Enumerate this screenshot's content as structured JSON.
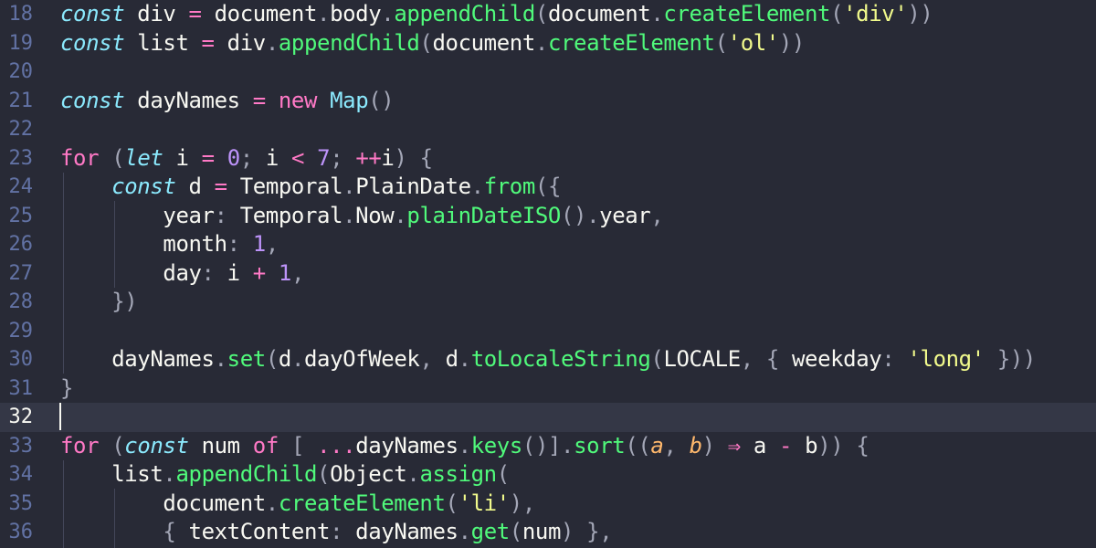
{
  "editor": {
    "theme_colors": {
      "background": "#282a36",
      "keyword": "#ff79c6",
      "storage": "#8be9fd",
      "function": "#50fa7b",
      "string": "#f1fa8c",
      "number": "#bd93f9",
      "parameter": "#ffb86c"
    },
    "current_line": "32",
    "lines": [
      {
        "num": "18",
        "tokens": [
          [
            "store",
            "const"
          ],
          [
            "text",
            " div "
          ],
          [
            "key",
            "="
          ],
          [
            "text",
            " document"
          ],
          [
            "punc",
            "."
          ],
          [
            "text",
            "body"
          ],
          [
            "punc",
            "."
          ],
          [
            "fn",
            "appendChild"
          ],
          [
            "punc",
            "("
          ],
          [
            "text",
            "document"
          ],
          [
            "punc",
            "."
          ],
          [
            "fn",
            "createElement"
          ],
          [
            "punc",
            "("
          ],
          [
            "str",
            "'div'"
          ],
          [
            "punc",
            "))"
          ]
        ]
      },
      {
        "num": "19",
        "tokens": [
          [
            "store",
            "const"
          ],
          [
            "text",
            " list "
          ],
          [
            "key",
            "="
          ],
          [
            "text",
            " div"
          ],
          [
            "punc",
            "."
          ],
          [
            "fn",
            "appendChild"
          ],
          [
            "punc",
            "("
          ],
          [
            "text",
            "document"
          ],
          [
            "punc",
            "."
          ],
          [
            "fn",
            "createElement"
          ],
          [
            "punc",
            "("
          ],
          [
            "str",
            "'ol'"
          ],
          [
            "punc",
            "))"
          ]
        ]
      },
      {
        "num": "20",
        "tokens": []
      },
      {
        "num": "21",
        "tokens": [
          [
            "store",
            "const"
          ],
          [
            "text",
            " dayNames "
          ],
          [
            "key",
            "="
          ],
          [
            "text",
            " "
          ],
          [
            "key",
            "new"
          ],
          [
            "text",
            " "
          ],
          [
            "type",
            "Map"
          ],
          [
            "punc",
            "()"
          ]
        ]
      },
      {
        "num": "22",
        "tokens": []
      },
      {
        "num": "23",
        "tokens": [
          [
            "key",
            "for"
          ],
          [
            "text",
            " "
          ],
          [
            "punc",
            "("
          ],
          [
            "store",
            "let"
          ],
          [
            "text",
            " i "
          ],
          [
            "key",
            "="
          ],
          [
            "text",
            " "
          ],
          [
            "num",
            "0"
          ],
          [
            "punc",
            ";"
          ],
          [
            "text",
            " i "
          ],
          [
            "key",
            "<"
          ],
          [
            "text",
            " "
          ],
          [
            "num",
            "7"
          ],
          [
            "punc",
            ";"
          ],
          [
            "text",
            " "
          ],
          [
            "key",
            "++"
          ],
          [
            "text",
            "i"
          ],
          [
            "punc",
            ")"
          ],
          [
            "text",
            " "
          ],
          [
            "punc",
            "{"
          ]
        ]
      },
      {
        "num": "24",
        "tokens": [
          [
            "text",
            "    "
          ],
          [
            "store",
            "const"
          ],
          [
            "text",
            " d "
          ],
          [
            "key",
            "="
          ],
          [
            "text",
            " Temporal"
          ],
          [
            "punc",
            "."
          ],
          [
            "text",
            "PlainDate"
          ],
          [
            "punc",
            "."
          ],
          [
            "fn",
            "from"
          ],
          [
            "punc",
            "({"
          ]
        ]
      },
      {
        "num": "25",
        "tokens": [
          [
            "text",
            "        year"
          ],
          [
            "punc",
            ":"
          ],
          [
            "text",
            " Temporal"
          ],
          [
            "punc",
            "."
          ],
          [
            "text",
            "Now"
          ],
          [
            "punc",
            "."
          ],
          [
            "fn",
            "plainDateISO"
          ],
          [
            "punc",
            "()."
          ],
          [
            "text",
            "year"
          ],
          [
            "punc",
            ","
          ]
        ]
      },
      {
        "num": "26",
        "tokens": [
          [
            "text",
            "        month"
          ],
          [
            "punc",
            ":"
          ],
          [
            "text",
            " "
          ],
          [
            "num",
            "1"
          ],
          [
            "punc",
            ","
          ]
        ]
      },
      {
        "num": "27",
        "tokens": [
          [
            "text",
            "        day"
          ],
          [
            "punc",
            ":"
          ],
          [
            "text",
            " i "
          ],
          [
            "key",
            "+"
          ],
          [
            "text",
            " "
          ],
          [
            "num",
            "1"
          ],
          [
            "punc",
            ","
          ]
        ]
      },
      {
        "num": "28",
        "tokens": [
          [
            "text",
            "    "
          ],
          [
            "punc",
            "})"
          ]
        ]
      },
      {
        "num": "29",
        "tokens": []
      },
      {
        "num": "30",
        "tokens": [
          [
            "text",
            "    dayNames"
          ],
          [
            "punc",
            "."
          ],
          [
            "fn",
            "set"
          ],
          [
            "punc",
            "("
          ],
          [
            "text",
            "d"
          ],
          [
            "punc",
            "."
          ],
          [
            "text",
            "dayOfWeek"
          ],
          [
            "punc",
            ","
          ],
          [
            "text",
            " d"
          ],
          [
            "punc",
            "."
          ],
          [
            "fn",
            "toLocaleString"
          ],
          [
            "punc",
            "("
          ],
          [
            "text",
            "LOCALE"
          ],
          [
            "punc",
            ","
          ],
          [
            "text",
            " "
          ],
          [
            "punc",
            "{"
          ],
          [
            "text",
            " weekday"
          ],
          [
            "punc",
            ":"
          ],
          [
            "text",
            " "
          ],
          [
            "str",
            "'long'"
          ],
          [
            "text",
            " "
          ],
          [
            "punc",
            "}))"
          ]
        ]
      },
      {
        "num": "31",
        "tokens": [
          [
            "punc",
            "}"
          ]
        ]
      },
      {
        "num": "32",
        "tokens": []
      },
      {
        "num": "33",
        "tokens": [
          [
            "key",
            "for"
          ],
          [
            "text",
            " "
          ],
          [
            "punc",
            "("
          ],
          [
            "store",
            "const"
          ],
          [
            "text",
            " num "
          ],
          [
            "key",
            "of"
          ],
          [
            "text",
            " "
          ],
          [
            "punc",
            "["
          ],
          [
            "text",
            " "
          ],
          [
            "key",
            "..."
          ],
          [
            "text",
            "dayNames"
          ],
          [
            "punc",
            "."
          ],
          [
            "fn",
            "keys"
          ],
          [
            "punc",
            "()]."
          ],
          [
            "fn",
            "sort"
          ],
          [
            "punc",
            "(("
          ],
          [
            "param",
            "a"
          ],
          [
            "punc",
            ","
          ],
          [
            "text",
            " "
          ],
          [
            "param",
            "b"
          ],
          [
            "punc",
            ")"
          ],
          [
            "text",
            " "
          ],
          [
            "key",
            "⇒"
          ],
          [
            "text",
            " a "
          ],
          [
            "key",
            "-"
          ],
          [
            "text",
            " b"
          ],
          [
            "punc",
            "))"
          ],
          [
            "text",
            " "
          ],
          [
            "punc",
            "{"
          ]
        ]
      },
      {
        "num": "34",
        "tokens": [
          [
            "text",
            "    list"
          ],
          [
            "punc",
            "."
          ],
          [
            "fn",
            "appendChild"
          ],
          [
            "punc",
            "("
          ],
          [
            "text",
            "Object"
          ],
          [
            "punc",
            "."
          ],
          [
            "fn",
            "assign"
          ],
          [
            "punc",
            "("
          ]
        ]
      },
      {
        "num": "35",
        "tokens": [
          [
            "text",
            "        document"
          ],
          [
            "punc",
            "."
          ],
          [
            "fn",
            "createElement"
          ],
          [
            "punc",
            "("
          ],
          [
            "str",
            "'li'"
          ],
          [
            "punc",
            "),"
          ]
        ]
      },
      {
        "num": "36",
        "tokens": [
          [
            "text",
            "        "
          ],
          [
            "punc",
            "{"
          ],
          [
            "text",
            " textContent"
          ],
          [
            "punc",
            ":"
          ],
          [
            "text",
            " dayNames"
          ],
          [
            "punc",
            "."
          ],
          [
            "fn",
            "get"
          ],
          [
            "punc",
            "("
          ],
          [
            "text",
            "num"
          ],
          [
            "punc",
            ")"
          ],
          [
            "text",
            " "
          ],
          [
            "punc",
            "},"
          ]
        ]
      }
    ]
  }
}
